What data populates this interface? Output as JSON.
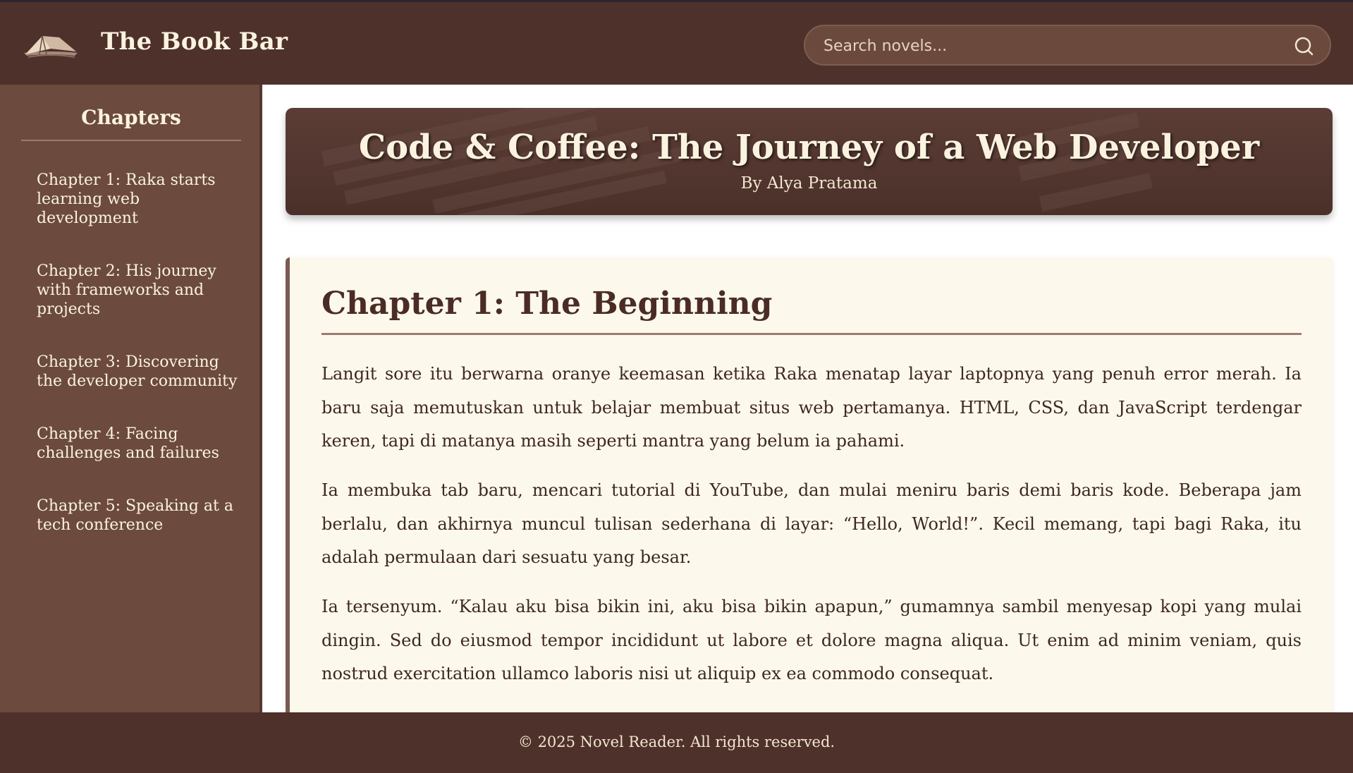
{
  "header": {
    "site_title": "The Book Bar",
    "logo_icon": "open-book-icon",
    "search": {
      "placeholder": "Search novels...",
      "value": "",
      "icon": "search-icon"
    }
  },
  "sidebar": {
    "heading": "Chapters",
    "chapters": [
      {
        "label": "Chapter 1: Raka starts learning web development"
      },
      {
        "label": "Chapter 2: His journey with frameworks and projects"
      },
      {
        "label": "Chapter 3: Discovering the developer community"
      },
      {
        "label": "Chapter 4: Facing challenges and failures"
      },
      {
        "label": "Chapter 5: Speaking at a tech conference"
      }
    ]
  },
  "banner": {
    "title": "Code & Coffee: The Journey of a Web Developer",
    "author": "By Alya Pratama"
  },
  "chapter": {
    "title": "Chapter 1: The Beginning",
    "paragraphs": [
      "Langit sore itu berwarna oranye keemasan ketika Raka menatap layar laptopnya yang penuh error merah. Ia baru saja memutuskan untuk belajar membuat situs web pertamanya. HTML, CSS, dan JavaScript terdengar keren, tapi di matanya masih seperti mantra yang belum ia pahami.",
      "Ia membuka tab baru, mencari tutorial di YouTube, dan mulai meniru baris demi baris kode. Beberapa jam berlalu, dan akhirnya muncul tulisan sederhana di layar: “Hello, World!”. Kecil memang, tapi bagi Raka, itu adalah permulaan dari sesuatu yang besar.",
      "Ia tersenyum. “Kalau aku bisa bikin ini, aku bisa bikin apapun,” gumamnya sambil menyesap kopi yang mulai dingin. Sed do eiusmod tempor incididunt ut labore et dolore magna aliqua. Ut enim ad minim veniam, quis nostrud exercitation ullamco laboris nisi ut aliquip ex ea commodo consequat."
    ]
  },
  "footer": {
    "text": "© 2025 Novel Reader. All rights reserved."
  },
  "colors": {
    "header_bg": "#4e312b",
    "sidebar_bg": "#6c4a3e",
    "card_bg": "#fdf8ec",
    "text_cream": "#fbf3df",
    "body_text": "#3e2722"
  }
}
